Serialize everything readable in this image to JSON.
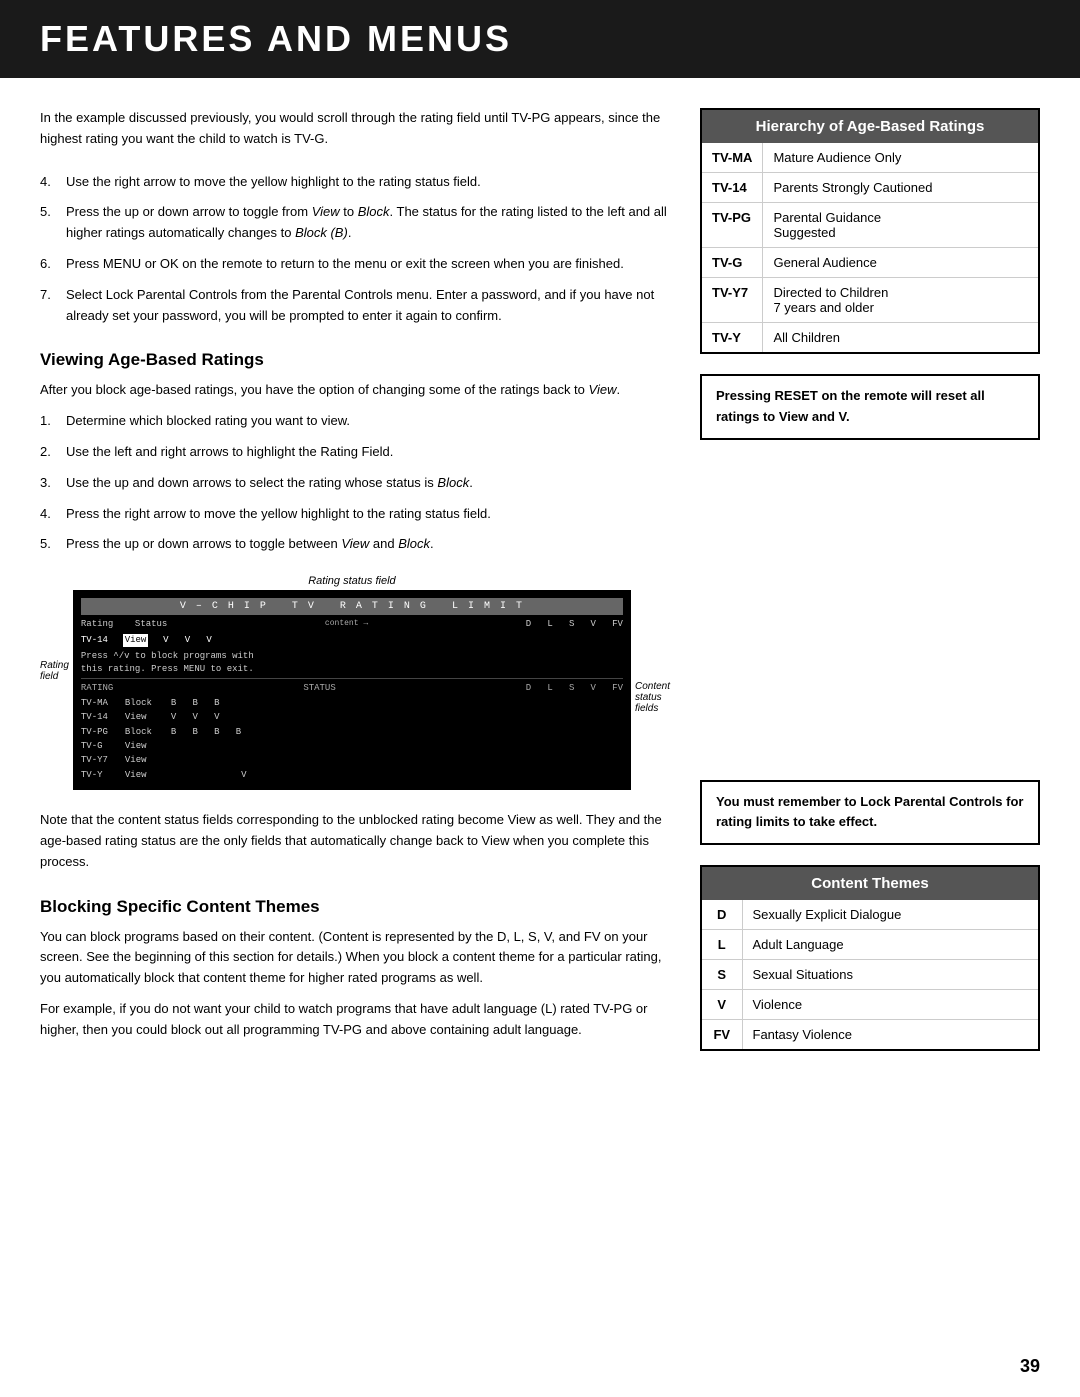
{
  "header": {
    "title": "FEATURES AND MENUS"
  },
  "intro": {
    "text": "In the example discussed previously, you would scroll through the rating field until TV-PG appears, since the highest rating you want the child to watch is TV-G."
  },
  "steps_top": [
    {
      "num": "4.",
      "text": "Use the right arrow to move the yellow highlight to the rating status field."
    },
    {
      "num": "5.",
      "text": "Press the up or down arrow to toggle from View to Block. The status for the rating listed to the left and all higher ratings automatically changes to Block (B)."
    },
    {
      "num": "6.",
      "text": "Press MENU or OK on the remote to return to the menu or exit the screen when you are finished."
    },
    {
      "num": "7.",
      "text": "Select Lock Parental Controls from the Parental Controls menu. Enter a password, and if you have not already set your password, you will be prompted to enter it again to confirm."
    }
  ],
  "hierarchy_box": {
    "title": "Hierarchy of Age-Based Ratings",
    "rows": [
      {
        "code": "TV-MA",
        "description": "Mature Audience Only"
      },
      {
        "code": "TV-14",
        "description": "Parents Strongly Cautioned"
      },
      {
        "code": "TV-PG",
        "description": "Parental Guidance Suggested"
      },
      {
        "code": "TV-G",
        "description": "General Audience"
      },
      {
        "code": "TV-Y7",
        "description": "Directed to Children\n7 years and older"
      },
      {
        "code": "TV-Y",
        "description": "All Children"
      }
    ]
  },
  "reset_note": {
    "text": "Pressing RESET on the remote will reset all ratings to View and V."
  },
  "viewing_section": {
    "heading": "Viewing Age-Based Ratings",
    "intro": "After you block age-based ratings, you have the option of changing some of the ratings back to View.",
    "steps": [
      {
        "num": "1.",
        "text": "Determine which blocked rating you want to view."
      },
      {
        "num": "2.",
        "text": "Use the left and right arrows to highlight the Rating Field."
      },
      {
        "num": "3.",
        "text": "Use the up and down arrows to select the rating whose status is Block."
      },
      {
        "num": "4.",
        "text": "Press the right arrow to move the yellow highlight to the rating status field."
      },
      {
        "num": "5.",
        "text": "Press the up or down arrows to toggle between View and Block."
      }
    ],
    "note": "Note that the content status fields corresponding to the unblocked rating become View as well. They and the age-based rating status are the only fields that automatically change back to View when you complete this process."
  },
  "tv_screen": {
    "rating_status_label": "Rating status field",
    "rating_field_label": "Rating\nfield",
    "content_status_label": "Content\nstatus\nfields",
    "title_bar": "V – C H I P   T V   R A T I N G   L I M I T",
    "header_cols": "Rating    Status    D  L  S  V  FV",
    "content_label": "content →",
    "highlight_row": "TV-14    View    V  V  V",
    "message": "Press ^/v to block programs with\nthis rating. Press MENU to exit.",
    "rows": [
      {
        "rating": "RATING",
        "status": "STATUS",
        "d": "D",
        "l": "L",
        "s": "S",
        "v": "V",
        "fv": "FV"
      },
      {
        "rating": "TV-MA",
        "status": "Block",
        "d": "B",
        "l": "B",
        "s": "B",
        "v": "",
        "fv": ""
      },
      {
        "rating": "TV-14",
        "status": "View",
        "d": "V",
        "l": "V",
        "s": "V",
        "v": "",
        "fv": ""
      },
      {
        "rating": "TV-PG",
        "status": "Block",
        "d": "B",
        "l": "B",
        "s": "B",
        "v": "B",
        "fv": ""
      },
      {
        "rating": "TV-G",
        "status": "View",
        "d": "",
        "l": "",
        "s": "",
        "v": "",
        "fv": ""
      },
      {
        "rating": "TV-Y7",
        "status": "View",
        "d": "",
        "l": "",
        "s": "",
        "v": "",
        "fv": ""
      },
      {
        "rating": "TV-Y",
        "status": "View",
        "d": "",
        "l": "",
        "s": "",
        "v": "V",
        "fv": ""
      }
    ]
  },
  "lock_note": {
    "text": "You must remember to Lock Parental Controls for rating limits to take effect."
  },
  "blocking_section": {
    "heading": "Blocking Specific Content Themes",
    "para1": "You can block programs based on their content. (Content is represented by the D, L, S, V, and FV on your screen. See the beginning of this section for details.) When you block a content theme for a particular rating, you automatically block that content theme for higher rated programs as well.",
    "para2": "For example, if you do not want your child to watch programs that have adult language (L) rated TV-PG or higher, then you could block out all programming TV-PG and above containing adult language."
  },
  "content_themes_box": {
    "title": "Content Themes",
    "rows": [
      {
        "code": "D",
        "description": "Sexually Explicit Dialogue"
      },
      {
        "code": "L",
        "description": "Adult Language"
      },
      {
        "code": "S",
        "description": "Sexual Situations"
      },
      {
        "code": "V",
        "description": "Violence"
      },
      {
        "code": "FV",
        "description": "Fantasy Violence"
      }
    ]
  },
  "page_number": "39"
}
